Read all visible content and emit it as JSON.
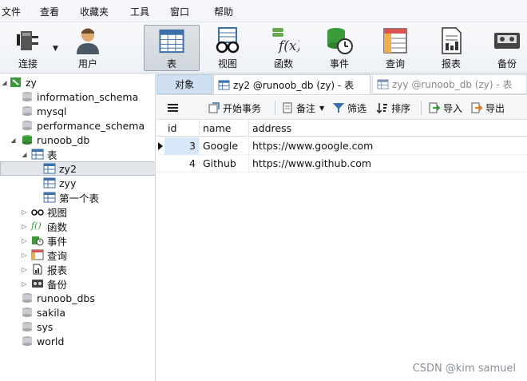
{
  "menu": [
    "文件",
    "查看",
    "收藏夹",
    "工具",
    "窗口",
    "帮助"
  ],
  "toolbar": {
    "connect": "连接",
    "user": "用户",
    "table": "表",
    "view": "视图",
    "function": "函数",
    "event": "事件",
    "query": "查询",
    "report": "报表",
    "backup": "备份"
  },
  "tree": {
    "connection": "zy",
    "db_information_schema": "information_schema",
    "db_mysql": "mysql",
    "db_performance_schema": "performance_schema",
    "db_runoob": "runoob_db",
    "tables_group": "表",
    "table_zy2": "zy2",
    "table_zyy": "zyy",
    "table_first": "第一个表",
    "views": "视图",
    "functions": "函数",
    "events": "事件",
    "queries": "查询",
    "reports": "报表",
    "backups": "备份",
    "db_runoob_dbs": "runoob_dbs",
    "db_sakila": "sakila",
    "db_sys": "sys",
    "db_world": "world"
  },
  "tabs": {
    "objects": "对象",
    "zy2": "zy2 @runoob_db (zy) - 表",
    "zyy": "zyy @runoob_db (zy) - 表"
  },
  "actions": {
    "begin_transaction": "开始事务",
    "memo": "备注",
    "filter": "筛选",
    "sort": "排序",
    "import": "导入",
    "export": "导出"
  },
  "grid": {
    "columns": [
      "id",
      "name",
      "address"
    ],
    "rows": [
      [
        "3",
        "Google",
        "https://www.google.com"
      ],
      [
        "4",
        "Github",
        "https://www.github.com"
      ]
    ]
  },
  "watermark": "CSDN @kim samuel",
  "colors": {
    "selected_cell": "#d7e8f8",
    "objects_tab": "#cfe0f2",
    "db_green": "#3a9a3a"
  }
}
